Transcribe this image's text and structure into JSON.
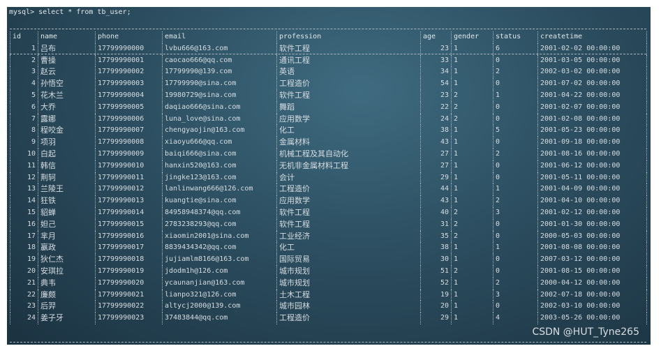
{
  "terminal": {
    "command": "mysql> select * from tb_user;"
  },
  "columns": [
    "id",
    "name",
    "phone",
    "email",
    "profession",
    "age",
    "gender",
    "status",
    "createtime"
  ],
  "rows": [
    [
      "1",
      "吕布",
      "17799990000",
      "lvbu666@163.com",
      "软件工程",
      "23",
      "1",
      "6",
      "2001-02-02 00:00:00"
    ],
    [
      "2",
      "曹操",
      "17799990001",
      "caocao666@qq.com",
      "通讯工程",
      "33",
      "1",
      "0",
      "2001-03-05 00:00:00"
    ],
    [
      "3",
      "赵云",
      "17799990002",
      "17799990@139.com",
      "英语",
      "34",
      "1",
      "2",
      "2002-03-02 00:00:00"
    ],
    [
      "4",
      "孙悟空",
      "17799990003",
      "17799990@sina.com",
      "工程造价",
      "54",
      "1",
      "0",
      "2001-07-02 00:00:00"
    ],
    [
      "5",
      "花木兰",
      "17799990004",
      "19980729@sina.com",
      "软件工程",
      "23",
      "2",
      "1",
      "2001-04-22 00:00:00"
    ],
    [
      "6",
      "大乔",
      "17799990005",
      "daqiao666@sina.com",
      "舞蹈",
      "22",
      "2",
      "0",
      "2001-02-07 00:00:00"
    ],
    [
      "7",
      "露娜",
      "17799990006",
      "luna_love@sina.com",
      "应用数学",
      "24",
      "2",
      "0",
      "2001-02-08 00:00:00"
    ],
    [
      "8",
      "程咬金",
      "17799990007",
      "chengyaojin@163.com",
      "化工",
      "38",
      "1",
      "5",
      "2001-05-23 00:00:00"
    ],
    [
      "9",
      "项羽",
      "17799990008",
      "xiaoyu666@qq.com",
      "金属材料",
      "43",
      "1",
      "0",
      "2001-09-18 00:00:00"
    ],
    [
      "10",
      "白起",
      "17799990009",
      "baiqi666@sina.com",
      "机械工程及其自动化",
      "27",
      "1",
      "2",
      "2001-08-16 00:00:00"
    ],
    [
      "11",
      "韩信",
      "17799990010",
      "hanxin520@163.com",
      "无机非金属材料工程",
      "27",
      "1",
      "0",
      "2001-06-12 00:00:00"
    ],
    [
      "12",
      "荆轲",
      "17799990011",
      "jingke123@163.com",
      "会计",
      "29",
      "1",
      "0",
      "2001-05-11 00:00:00"
    ],
    [
      "13",
      "兰陵王",
      "17799990012",
      "lanlinwang666@126.com",
      "工程造价",
      "44",
      "1",
      "1",
      "2001-04-09 00:00:00"
    ],
    [
      "14",
      "狂铁",
      "17799990013",
      "kuangtie@sina.com",
      "应用数学",
      "43",
      "1",
      "2",
      "2001-04-10 00:00:00"
    ],
    [
      "15",
      "貂蝉",
      "17799990014",
      "84958948374@qq.com",
      "软件工程",
      "40",
      "2",
      "3",
      "2001-02-12 00:00:00"
    ],
    [
      "16",
      "妲己",
      "17799990015",
      "2783238293@qq.com",
      "软件工程",
      "31",
      "2",
      "0",
      "2001-01-30 00:00:00"
    ],
    [
      "17",
      "芈月",
      "17799990016",
      "xiaomin2001@sina.com",
      "工业经济",
      "35",
      "2",
      "0",
      "2000-05-03 00:00:00"
    ],
    [
      "18",
      "嬴政",
      "17799990017",
      "8839434342@qq.com",
      "化工",
      "38",
      "1",
      "1",
      "2001-08-08 00:00:00"
    ],
    [
      "19",
      "狄仁杰",
      "17799990018",
      "jujiamlm8166@163.com",
      "国际贸易",
      "30",
      "1",
      "0",
      "2007-03-12 00:00:00"
    ],
    [
      "20",
      "安琪拉",
      "17799990019",
      "jdodm1h@126.com",
      "城市规划",
      "51",
      "2",
      "0",
      "2001-08-15 00:00:00"
    ],
    [
      "21",
      "典韦",
      "17799990020",
      "ycaunanjian@163.com",
      "城市规划",
      "52",
      "1",
      "2",
      "2000-04-12 00:00:00"
    ],
    [
      "22",
      "廉颇",
      "17799990021",
      "lianpo321@126.com",
      "土木工程",
      "19",
      "1",
      "3",
      "2002-07-18 00:00:00"
    ],
    [
      "23",
      "后羿",
      "17799990022",
      "altycj2000@139.com",
      "城市园林",
      "20",
      "1",
      "0",
      "2002-03-10 00:00:00"
    ],
    [
      "24",
      "姜子牙",
      "17799990023",
      "37483844@qq.com",
      "工程造价",
      "29",
      "1",
      "4",
      "2003-05-26 00:00:00"
    ]
  ],
  "watermark": "CSDN @HUT_Tyne265"
}
